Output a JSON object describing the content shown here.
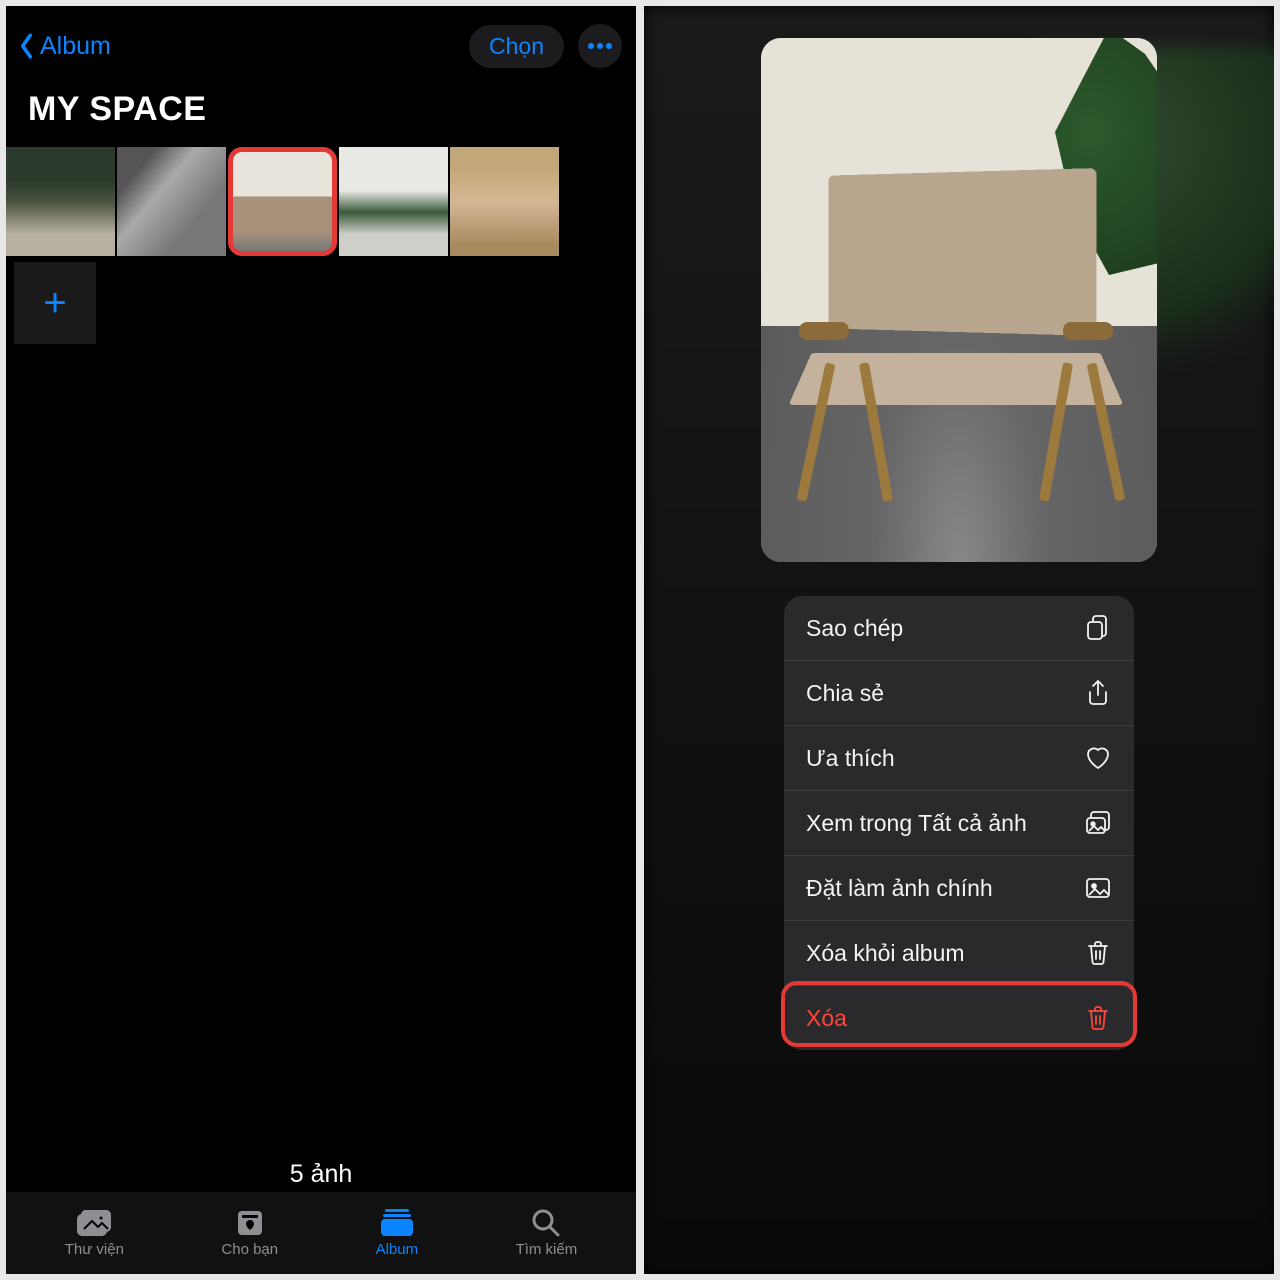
{
  "left": {
    "back_label": "Album",
    "select_label": "Chọn",
    "title": "MY SPACE",
    "photo_count": "5 ảnh",
    "tabs": {
      "library": "Thư viện",
      "for_you": "Cho bạn",
      "albums": "Album",
      "search": "Tìm kiếm"
    }
  },
  "menu": {
    "copy": "Sao chép",
    "share": "Chia sẻ",
    "favorite": "Ưa thích",
    "view_all": "Xem trong Tất cả ảnh",
    "make_key": "Đặt làm ảnh chính",
    "remove_album": "Xóa khỏi album",
    "delete": "Xóa"
  },
  "colors": {
    "accent": "#0a84ff",
    "danger": "#ff453a",
    "highlight": "#e53935"
  }
}
